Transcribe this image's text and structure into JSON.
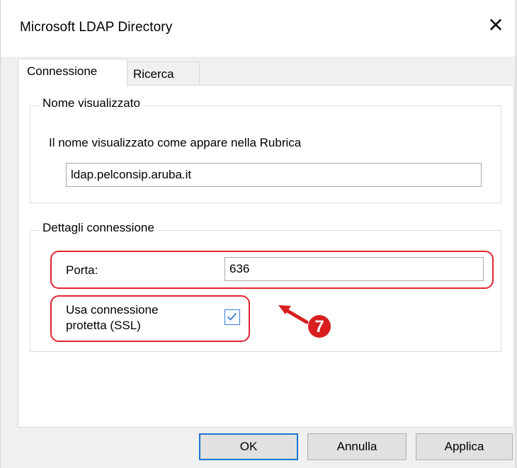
{
  "window": {
    "title": "Microsoft LDAP Directory",
    "close_glyph": "✕"
  },
  "tabs": [
    {
      "label": "Connessione",
      "active": true
    },
    {
      "label": "Ricerca",
      "active": false
    }
  ],
  "display_name_group": {
    "title": "Nome visualizzato",
    "description": "Il nome visualizzato come appare nella Rubrica",
    "value": "ldap.pelconsip.aruba.it"
  },
  "connection_group": {
    "title": "Dettagli connessione",
    "port_label": "Porta:",
    "port_value": "636",
    "ssl_label_line1": "Usa connessione",
    "ssl_label_line2": "protetta (SSL)",
    "ssl_checked": true
  },
  "annotation": {
    "step_number": "7",
    "color": "#d81e1e"
  },
  "buttons": {
    "ok": "OK",
    "cancel": "Annulla",
    "apply": "Applica"
  },
  "colors": {
    "highlight": "#e0252f",
    "focus": "#1d74d1",
    "checkbox": "#3a7bd5"
  }
}
